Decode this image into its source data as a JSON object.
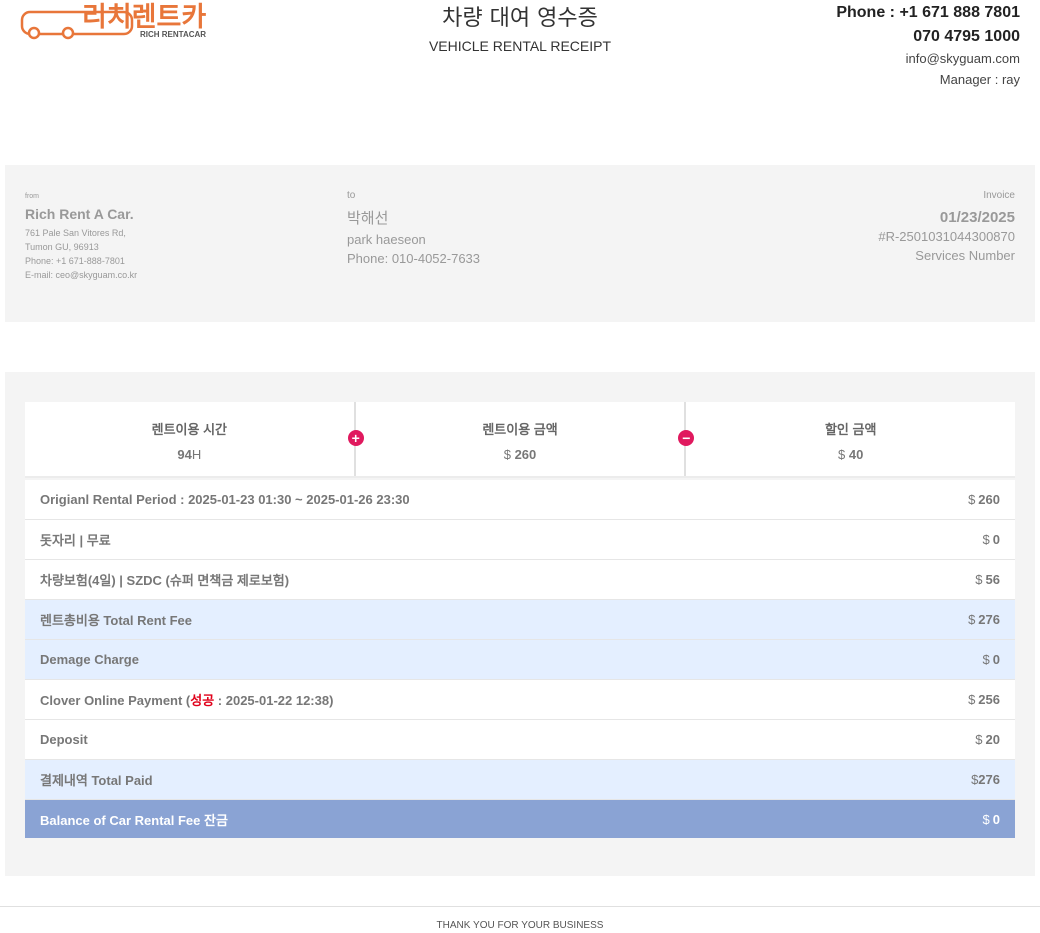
{
  "header": {
    "logo_text_ko": "리치렌트카",
    "logo_text_en": "RICH RENTACAR",
    "title_ko": "차량 대여 영수증",
    "title_en": "VEHICLE RENTAL RECEIPT",
    "phone1": "Phone : +1 671 888 7801",
    "phone2": "070 4795 1000",
    "email": "info@skyguam.com",
    "manager": "Manager : ray"
  },
  "from": {
    "label": "from",
    "company": "Rich Rent A Car.",
    "address1": "761 Pale San Vitores Rd,",
    "address2": "Tumon GU, 96913",
    "phone": "Phone: +1 671-888-7801",
    "email": "E-mail: ceo@skyguam.co.kr"
  },
  "to": {
    "label": "to",
    "name_ko": "박해선",
    "name_en": "park haeseon",
    "phone": "Phone: 010-4052-7633"
  },
  "invoice": {
    "label": "Invoice",
    "date": "01/23/2025",
    "number": "#R-2501031044300870",
    "services_label": "Services Number"
  },
  "summary": [
    {
      "label": "렌트이용 시간",
      "value": "94",
      "unit": "H"
    },
    {
      "label": "렌트이용 금액",
      "currency": "$",
      "value": "260"
    },
    {
      "label": "할인 금액",
      "currency": "$",
      "value": "40"
    }
  ],
  "rows": [
    {
      "label": "Origianl Rental Period : 2025-01-23 01:30 ~ 2025-01-26 23:30",
      "currency": "$",
      "amount": "260"
    },
    {
      "label": "돗자리 | 무료",
      "currency": "$",
      "amount": "0"
    },
    {
      "label": "차량보험(4일) | SZDC (슈퍼 면책금 제로보험)",
      "currency": "$",
      "amount": "56"
    },
    {
      "label": "렌트총비용 Total Rent Fee",
      "currency": "$",
      "amount": "276"
    },
    {
      "label": "Demage Charge",
      "currency": "$",
      "amount": "0"
    },
    {
      "label_pre": "Clover Online Payment (",
      "label_status": "성공",
      "label_post": " : 2025-01-22 12:38)",
      "currency": "$",
      "amount": "256"
    },
    {
      "label": "Deposit",
      "currency": "$",
      "amount": "20"
    },
    {
      "label": "결제내역 Total Paid",
      "currency": "$",
      "amount": "276"
    },
    {
      "label": "Balance of Car Rental Fee 잔금",
      "currency": "$",
      "amount": "0"
    }
  ],
  "footer": "THANK YOU FOR YOUR BUSINESS",
  "colors": {
    "logo_orange": "#e8763a",
    "balance_row": "#8aa3d4",
    "highlight_row": "#e4efff",
    "operator_icon": "#e0195e",
    "status_red": "#e0001a"
  }
}
